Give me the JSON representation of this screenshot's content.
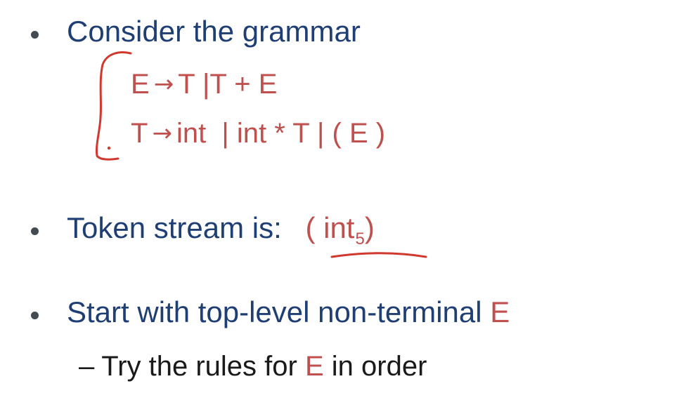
{
  "slide": {
    "bullets": [
      {
        "text": "Consider the grammar"
      },
      {
        "text": "Token stream is:",
        "token_open": "( int",
        "token_sub": "5",
        "token_close": ")"
      },
      {
        "text": "Start with top-level non-terminal",
        "highlight": "E"
      }
    ],
    "grammar": {
      "rule1": {
        "lhs": "E",
        "arrow": "→",
        "rhs": "T |T + E"
      },
      "rule2": {
        "lhs": "T",
        "arrow": "→",
        "rhs": "int  | int * T | ( E )"
      }
    },
    "sub_bullet": {
      "dash": "–",
      "before": "Try the rules for",
      "highlight": "E",
      "after": "in order"
    },
    "colors": {
      "blue_text": "#1f3f74",
      "red_text": "#c0504d",
      "annotation_red": "#d0392e",
      "bullet_dot": "#444a52"
    }
  }
}
